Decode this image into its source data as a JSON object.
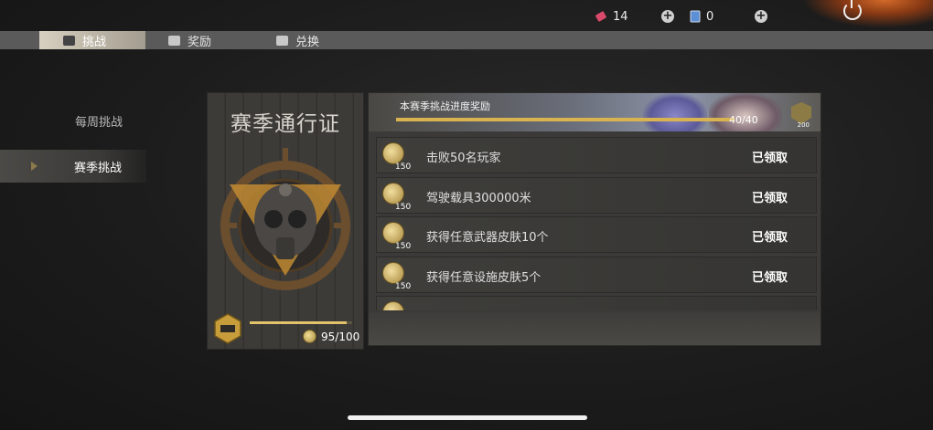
{
  "topbar": {
    "tickets": {
      "icon": "ticket-icon",
      "value": "14"
    },
    "cards": {
      "icon": "card-icon",
      "value": "0"
    },
    "power_icon": "power-icon"
  },
  "tabs": [
    {
      "label": "挑战",
      "icon": "challenge-icon",
      "active": true
    },
    {
      "label": "奖励",
      "icon": "reward-icon",
      "active": false
    },
    {
      "label": "兑换",
      "icon": "exchange-icon",
      "active": false
    }
  ],
  "sidebar": {
    "items": [
      {
        "label": "每周挑战",
        "active": false
      },
      {
        "label": "赛季挑战",
        "active": true
      }
    ]
  },
  "pass_card": {
    "title": "赛季通行证",
    "progress": {
      "current": 95,
      "max": 100,
      "text": "95/100"
    }
  },
  "season_banner": {
    "title": "本赛季挑战进度奖励",
    "progress": {
      "current": 40,
      "max": 40,
      "text": "40/40"
    },
    "reward_badge": "200"
  },
  "challenges": [
    {
      "reward": "150",
      "label": "击败50名玩家",
      "status": "已领取"
    },
    {
      "reward": "150",
      "label": "驾驶载具300000米",
      "status": "已领取"
    },
    {
      "reward": "150",
      "label": "获得任意武器皮肤10个",
      "status": "已领取"
    },
    {
      "reward": "150",
      "label": "获得任意设施皮肤5个",
      "status": "已领取"
    }
  ]
}
